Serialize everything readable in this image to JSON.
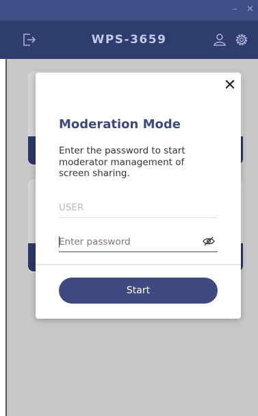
{
  "window": {
    "minimize_glyph": "–",
    "close_glyph": "✕"
  },
  "header": {
    "title": "WPS-3659",
    "left_icon": "logout-icon",
    "right_icons": [
      "user-icon",
      "settings-gear-icon"
    ]
  },
  "modal": {
    "close_glyph": "✕",
    "title": "Moderation Mode",
    "description": "Enter the password to start moderator management of screen sharing.",
    "user_field": {
      "value": "USER"
    },
    "password_field": {
      "value": "",
      "placeholder": "Enter password",
      "toggle_icon": "eye-slash-icon"
    },
    "start_label": "Start"
  },
  "colors": {
    "titlebar": "#3f4e84",
    "header": "#2f3c6e",
    "accent": "#3f4b80",
    "overlay": "#c8c8c8"
  }
}
